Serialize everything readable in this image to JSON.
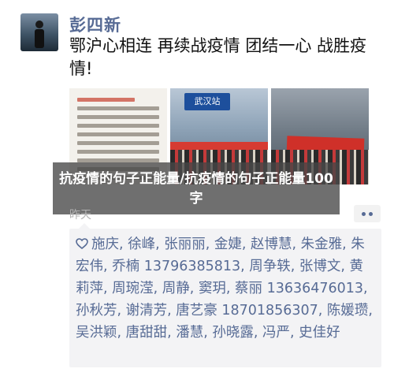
{
  "post": {
    "author": "彭四新",
    "text": "鄂沪心相连 再续战疫情 团结一心 战胜疫情!",
    "time": "昨天",
    "photos": [
      {
        "type": "document"
      },
      {
        "type": "station",
        "sign": "武汉站"
      },
      {
        "type": "hall"
      }
    ]
  },
  "overlay": {
    "title": "抗疫情的句子正能量/抗疫情的句子正能量100字"
  },
  "likes": {
    "names": "施庆, 徐峰, 张丽丽, 金婕, 赵博慧, 朱金雅, 朱宏伟, 乔楠 13796385813, 周争轶, 张博文, 黄莉萍, 周琬滢, 周静, 窦玥, 蔡丽 13636476013, 孙秋芳, 谢清芳, 唐艺豪 18701856307, 陈媛瓒, 吴洪颖, 唐甜甜, 潘慧, 孙晓露, 冯严, 史佳好"
  },
  "colors": {
    "link": "#576b95",
    "likes_bg": "#f3f3f5",
    "overlay_bg": "#464646"
  },
  "icons": [
    "avatar",
    "heart-icon",
    "more-icon"
  ]
}
